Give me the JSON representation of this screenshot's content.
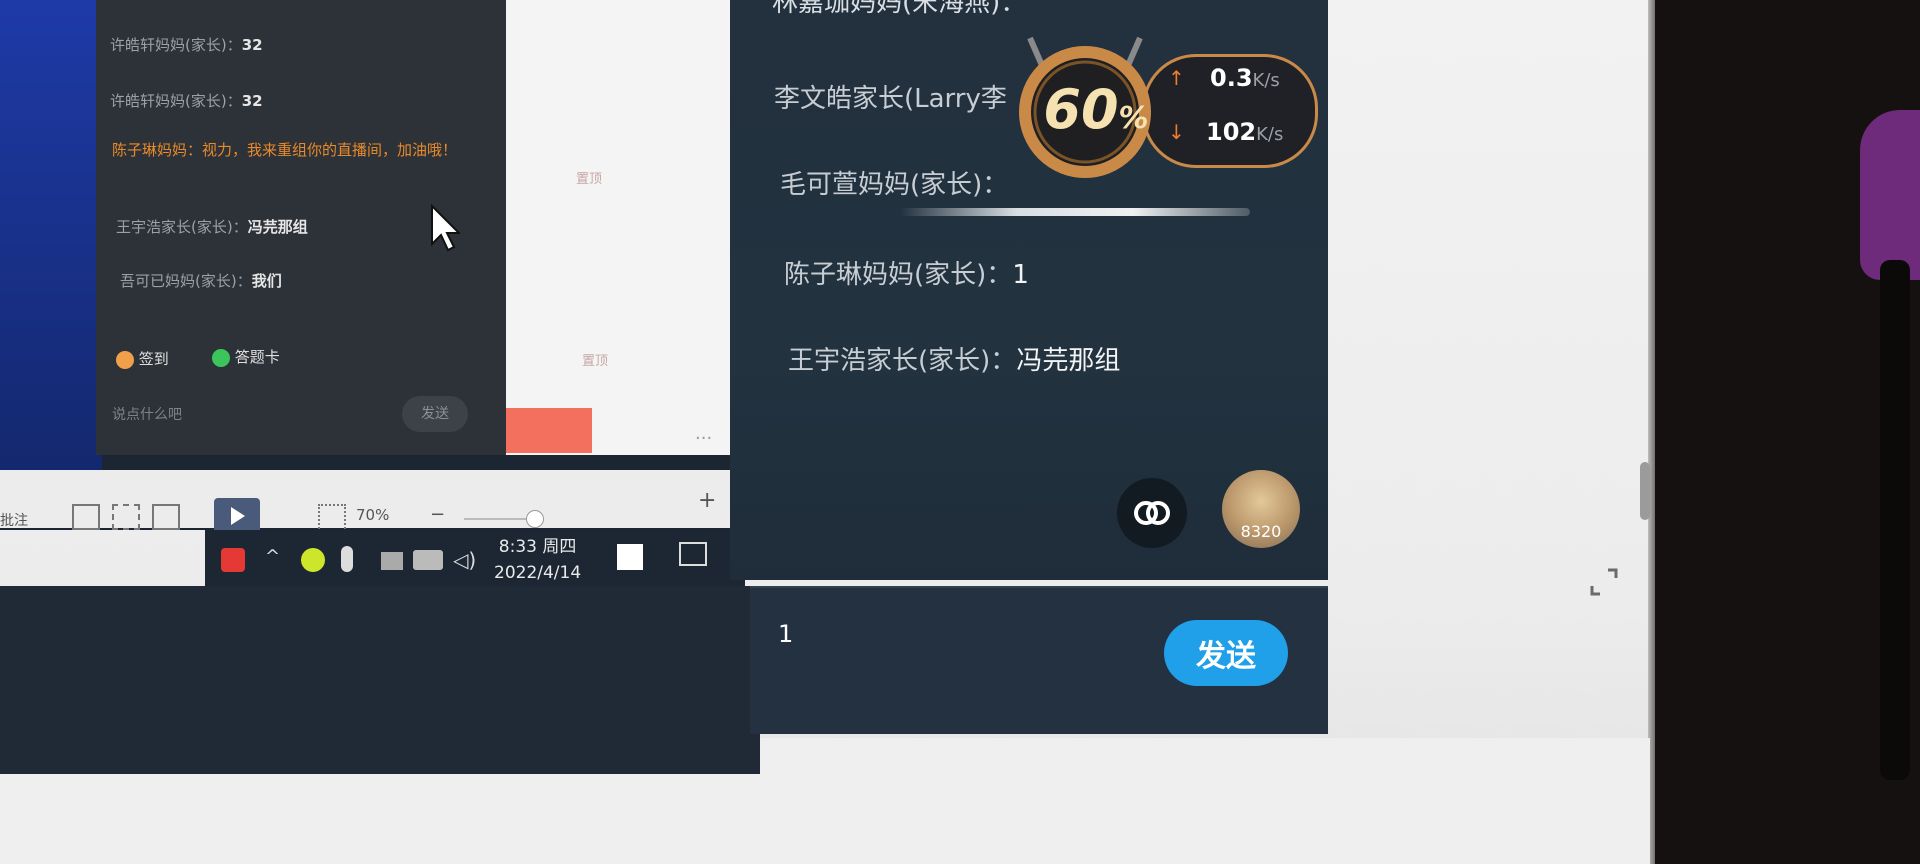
{
  "pc_screen": {
    "chat_messages": [
      {
        "name": "许皓轩妈妈(家长)：",
        "text": "32"
      },
      {
        "name": "许皓轩妈妈(家长)：",
        "text": "32"
      },
      {
        "name": "王宇浩家长(家长)：",
        "text": "冯芫那组"
      },
      {
        "name": "吾可已妈妈(家长)：",
        "text": "我们"
      }
    ],
    "orange_message": "陈子琳妈妈：视力，我来重组你的直播间，加油哦！",
    "sign_in": "签到",
    "points_card": "答题卡",
    "input_placeholder": "说点什么吧",
    "send_label": "发送",
    "side_gray_1": "置顶",
    "side_gray_2": "置顶",
    "toolbar_label": "批注",
    "zoom": "70%",
    "clock_time": "8:33 周四",
    "clock_date": "2022/4/14"
  },
  "chat": {
    "partial_top": "林嘉珈妈妈(宋海燕)：",
    "messages": [
      {
        "name": "李文皓家长(Larry李",
        "sep": "",
        "text": ""
      },
      {
        "name": "毛可萱妈妈(家长)",
        "sep": "：",
        "text": ""
      },
      {
        "name": "陈子琳妈妈(家长)",
        "sep": "：",
        "text": "1"
      },
      {
        "name": "王宇浩家长(家长)",
        "sep": "：",
        "text": "冯芫那组"
      }
    ],
    "avatar_count": "8320",
    "input_value": "1",
    "send_label": "发送"
  },
  "network": {
    "badge_value": "60",
    "badge_unit": "%",
    "upload": "0.3",
    "download": "102",
    "unit": "K/s"
  },
  "colors": {
    "chat_bg": "#23303e",
    "send_button": "#20a0e8",
    "badge_gold": "#c98a48"
  }
}
